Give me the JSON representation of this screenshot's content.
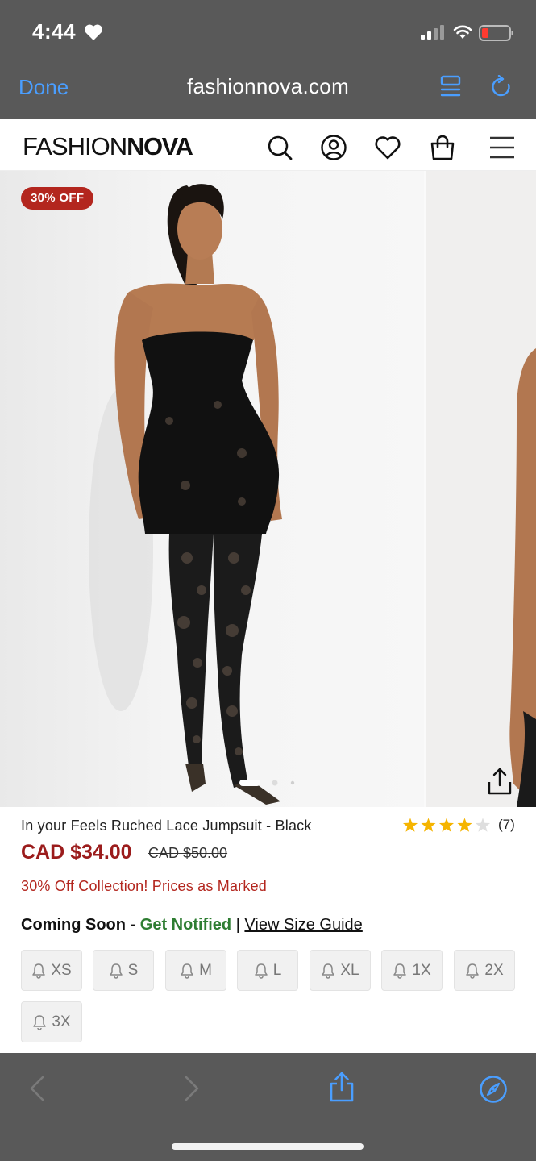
{
  "status_bar": {
    "time": "4:44"
  },
  "browser": {
    "done_label": "Done",
    "url": "fashionnova.com"
  },
  "site": {
    "logo_light": "FASHION",
    "logo_bold": "NOVA"
  },
  "product": {
    "badge": "30% OFF",
    "name": "In your Feels Ruched Lace Jumpsuit - Black",
    "rating": 4,
    "rating_max": 5,
    "review_count": "(7)",
    "price": "CAD $34.00",
    "original_price": "CAD $50.00",
    "promo": "30% Off Collection! Prices as Marked",
    "coming_soon": "Coming Soon",
    "dash": " - ",
    "get_notified": "Get Notified",
    "separator": " | ",
    "size_guide": "View Size Guide",
    "carousel_index": 1,
    "carousel_count": 3
  },
  "sizes": [
    "XS",
    "S",
    "M",
    "L",
    "XL",
    "1X",
    "2X",
    "3X"
  ],
  "colors": {
    "chrome_bg": "#595959",
    "accent_blue": "#4a9eff",
    "brand_red": "#b3261e",
    "price_red": "#9b1c1c",
    "notify_green": "#2e7d32"
  }
}
